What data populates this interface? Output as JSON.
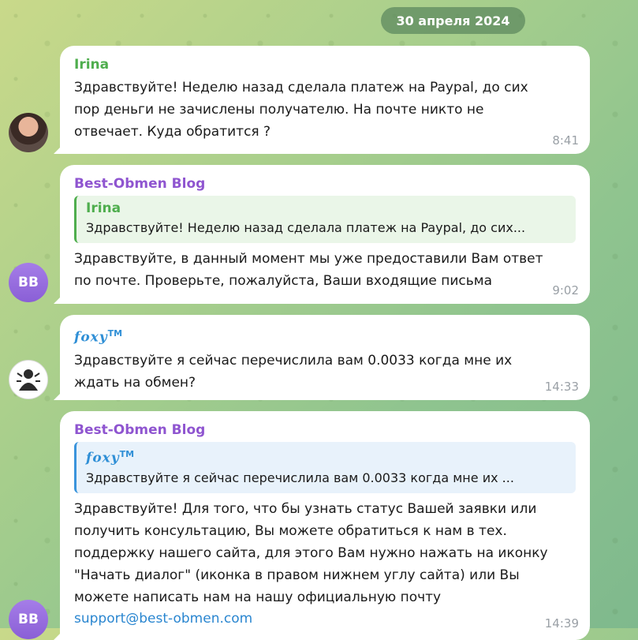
{
  "date_separator": "30 апреля 2024",
  "messages": [
    {
      "sender": "Irina",
      "text": "Здравствуйте! Неделю назад сделала платеж на Paypal, до сих\nпор деньги не зачислены получателю. На почте никто не\nотвечает. Куда обратится ?",
      "time": "8:41"
    },
    {
      "sender": "Best-Obmen Blog",
      "avatar_initials": "BB",
      "reply": {
        "sender": "Irina",
        "text": "Здравствуйте! Неделю назад сделала платеж на Paypal, до сих..."
      },
      "text": "Здравствуйте, в данный момент мы уже предоставили Вам ответ\nпо почте. Проверьте, пожалуйста, Ваши входящие письма",
      "time": "9:02"
    },
    {
      "sender": "foxy",
      "sender_mark": "TM",
      "text": "Здравствуйте я сейчас перечислила вам 0.0033 когда мне их\nждать на обмен?",
      "time": "14:33"
    },
    {
      "sender": "Best-Obmen Blog",
      "avatar_initials": "BB",
      "reply": {
        "sender": "foxy",
        "sender_mark": "TM",
        "text": "Здравствуйте я сейчас перечислила вам 0.0033 когда мне их ..."
      },
      "text": "Здравствуйте! Для того, что бы узнать статус Вашей заявки или\nполучить консультацию, Вы можете обратиться к нам в тех.\nподдержку нашего сайта, для этого Вам нужно нажать на иконку\n\"Начать диалог\" (иконка в правом нижнем углу сайта) или Вы\nможете написать нам на нашу официальную почту",
      "link": "support@best-obmen.com",
      "time": "14:39"
    }
  ],
  "colors": {
    "irina_name": "#4fae4e",
    "bb_name": "#8f55d0",
    "foxy_name": "#2f8fd6",
    "link": "#2a86d0"
  }
}
